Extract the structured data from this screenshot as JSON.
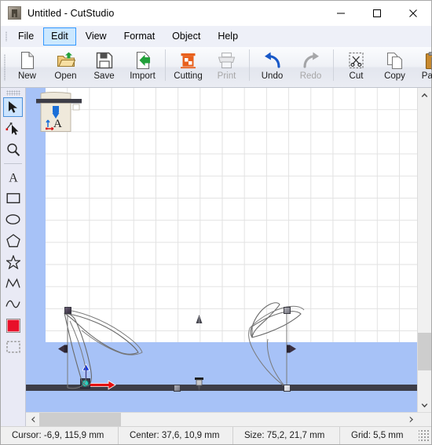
{
  "window": {
    "title": "Untitled - CutStudio",
    "app_icon": "cutstudio-logo-icon",
    "minimize_label": "Minimize",
    "maximize_label": "Maximize",
    "close_label": "Close"
  },
  "menubar": {
    "grip": "menu-drag-grip",
    "items": [
      {
        "label": "File",
        "active": false
      },
      {
        "label": "Edit",
        "active": true
      },
      {
        "label": "View",
        "active": false
      },
      {
        "label": "Format",
        "active": false
      },
      {
        "label": "Object",
        "active": false
      },
      {
        "label": "Help",
        "active": false
      }
    ]
  },
  "toolbar": {
    "grip": "toolbar-drag-grip",
    "buttons": [
      {
        "label": "New",
        "icon": "new-document-icon",
        "disabled": false
      },
      {
        "label": "Open",
        "icon": "open-folder-icon",
        "disabled": false
      },
      {
        "label": "Save",
        "icon": "floppy-disk-icon",
        "disabled": false
      },
      {
        "label": "Import",
        "icon": "import-arrow-icon",
        "disabled": false
      },
      {
        "label": "Cutting",
        "icon": "cutting-plotter-icon",
        "disabled": false
      },
      {
        "label": "Print",
        "icon": "printer-icon",
        "disabled": true
      },
      {
        "label": "Undo",
        "icon": "undo-arrow-icon",
        "disabled": false
      },
      {
        "label": "Redo",
        "icon": "redo-arrow-icon",
        "disabled": true
      },
      {
        "label": "Cut",
        "icon": "scissors-cut-icon",
        "disabled": false
      },
      {
        "label": "Copy",
        "icon": "copy-pages-icon",
        "disabled": false
      },
      {
        "label": "Paste",
        "icon": "clipboard-paste-icon",
        "disabled": false
      }
    ]
  },
  "tools": {
    "grip": "toolpalette-drag-grip",
    "items": [
      {
        "name": "select-arrow-tool",
        "selected": true
      },
      {
        "name": "node-edit-tool",
        "selected": false
      },
      {
        "name": "zoom-magnifier-tool",
        "selected": false
      },
      {
        "name": "text-tool",
        "selected": false
      },
      {
        "name": "rectangle-tool",
        "selected": false
      },
      {
        "name": "ellipse-tool",
        "selected": false
      },
      {
        "name": "polygon-tool",
        "selected": false
      },
      {
        "name": "star-tool",
        "selected": false
      },
      {
        "name": "polyline-tool",
        "selected": false
      },
      {
        "name": "curve-tool",
        "selected": false
      },
      {
        "name": "fill-color-swatch",
        "selected": false,
        "color": "#e8102a"
      },
      {
        "name": "marquee-select-tool",
        "selected": false
      }
    ]
  },
  "canvas": {
    "media_indicator": "media-load-direction-icon",
    "cutting_bar": "cutting-strip",
    "blade": "blade-carriage-icon",
    "pinch_roller": "pinch-roller-icon",
    "origin_marker": "origin-axes-marker",
    "axis_x_color": "#e41010",
    "axis_y_color": "#1030e0",
    "margin_color": "#a7c2f7",
    "sheet_color": "#ffffff",
    "grid_color": "#e2e2e2",
    "selection_handles": 8
  },
  "scrollbars": {
    "up_arrow": "scroll-up-arrow",
    "down_arrow": "scroll-down-arrow",
    "left_arrow": "scroll-left-arrow",
    "right_arrow": "scroll-right-arrow"
  },
  "statusbar": {
    "cursor": "Cursor: -6,9, 115,9 mm",
    "center": "Center: 37,6, 10,9 mm",
    "size": "Size: 75,2, 21,7 mm",
    "grid": "Grid: 5,5 mm",
    "resize_grip": "window-resize-grip"
  }
}
